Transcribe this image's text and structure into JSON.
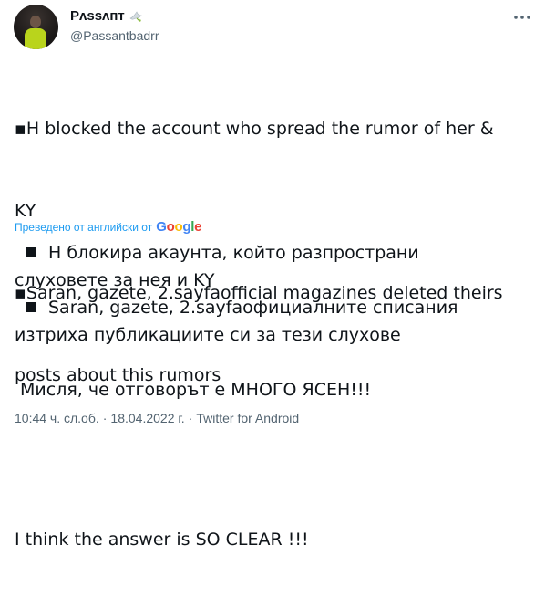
{
  "author": {
    "display_name": "Ρᴧѕѕᴧᴨт",
    "handle": "@Passantbadrr"
  },
  "tweet": {
    "lines": [
      "▪H blocked the account who spread the rumor of her &",
      "KY",
      "▪Saran, gazete, 2.sayfaofficial magazines deleted theirs",
      "posts about this rumors",
      "",
      "I think the answer is SO CLEAR !!!"
    ]
  },
  "translation": {
    "label": "Преведено от английски от",
    "provider": "Google",
    "lines": [
      "Н блокира акаунта, който разпространи",
      "слуховете за нея и KY",
      "Saran, gazete, 2.sayfaофициалните списания",
      "изтриха публикациите си за тези слухове",
      "",
      " Мисля, че отговорът е МНОГО ЯСЕН!!!"
    ]
  },
  "meta": {
    "time": "10:44 ч. сл.об.",
    "separator": "·",
    "date": "18.04.2022 г.",
    "source": "Twitter for Android"
  },
  "colors": {
    "text": "#0f1419",
    "secondary": "#536471",
    "link": "#1d9bf0"
  }
}
